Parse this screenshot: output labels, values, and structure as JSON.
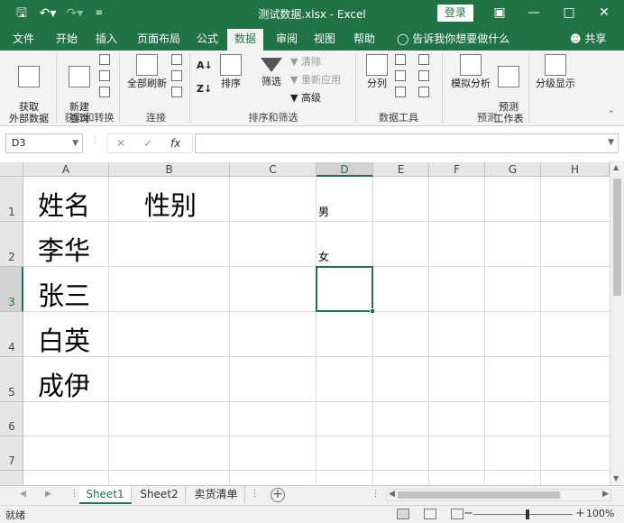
{
  "titlebar": {
    "title": "测试数据.xlsx - Excel",
    "login": "登录",
    "save_icon": "save-icon",
    "undo_icon": "undo-icon",
    "redo_icon": "redo-icon",
    "customize_icon": "customize-qa-icon"
  },
  "tabs": [
    "文件",
    "开始",
    "插入",
    "页面布局",
    "公式",
    "数据",
    "审阅",
    "视图",
    "帮助"
  ],
  "active_tab": "数据",
  "tellme": "告诉我你想要做什么",
  "share": "共享",
  "ribbon": {
    "get_external": "获取\n外部数据",
    "new_query": "新建\n查询",
    "refresh_all": "全部刷新",
    "sort": "排序",
    "filter": "筛选",
    "clear": "清除",
    "reapply": "重新应用",
    "advanced": "高级",
    "split": "分列",
    "whatif": "模拟分析",
    "forecast": "预测\n工作表",
    "outline": "分级显示",
    "groups": {
      "get_transform": "获取和转换",
      "connections": "连接",
      "sort_filter": "排序和筛选",
      "data_tools": "数据工具",
      "forecast": "预测"
    }
  },
  "formula_bar": {
    "name_box": "D3",
    "cancel": "✕",
    "enter": "✓",
    "fx": "fx",
    "value": ""
  },
  "columns": [
    "A",
    "B",
    "C",
    "D",
    "E",
    "F",
    "G",
    "H"
  ],
  "rows": [
    "1",
    "2",
    "3",
    "4",
    "5",
    "6",
    "7"
  ],
  "cells": {
    "A1": "姓名",
    "B1": "性别",
    "A2": "李华",
    "A3": "张三",
    "A4": "白英",
    "A5": "成伊",
    "D1": "男",
    "D2": "女"
  },
  "selected_cell": "D3",
  "sheets": [
    "Sheet1",
    "Sheet2",
    "卖货清单"
  ],
  "active_sheet": "Sheet1",
  "status": {
    "ready": "就绪",
    "zoom": "100%"
  }
}
